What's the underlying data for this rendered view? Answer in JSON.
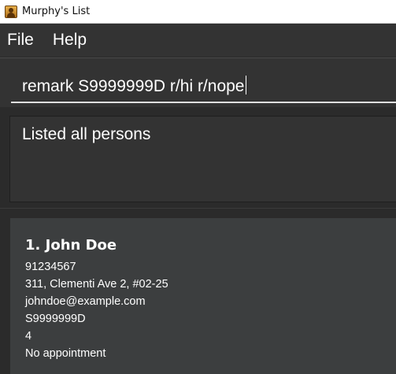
{
  "window": {
    "title": "Murphy's List"
  },
  "menu": {
    "items": [
      "File",
      "Help"
    ]
  },
  "command": {
    "value": "remark S9999999D r/hi r/nope"
  },
  "result": {
    "message": "Listed all persons"
  },
  "persons": [
    {
      "index_name": "1. John Doe",
      "phone": "91234567",
      "address": "311, Clementi Ave 2, #02-25",
      "email": "johndoe@example.com",
      "nric": "S9999999D",
      "remark": "4",
      "appointment": "No appointment"
    }
  ],
  "colors": {
    "background": "#2b2b2b",
    "panel": "#333333",
    "card": "#3c3e3f",
    "text": "#ffffff"
  },
  "icons": {
    "app": "person-app-icon"
  }
}
